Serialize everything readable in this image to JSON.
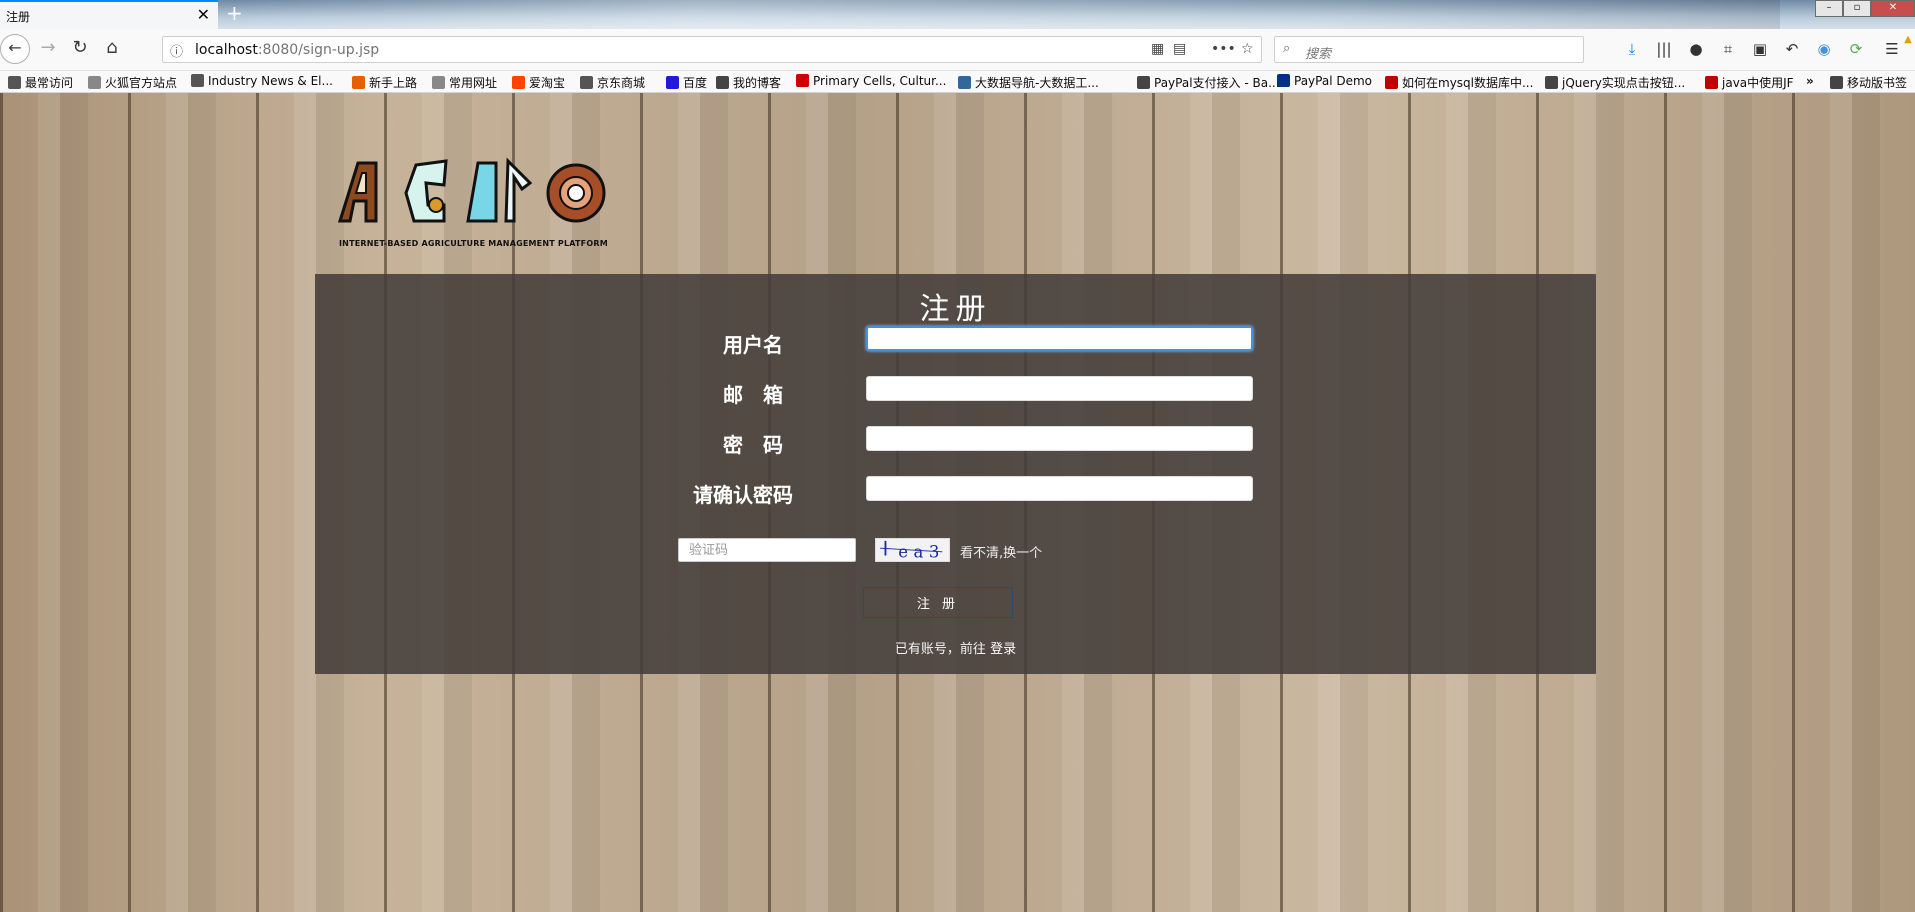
{
  "browser": {
    "tab_title": "注册",
    "new_tab_symbol": "+",
    "close_symbol": "✕",
    "url_host": "localhost",
    "url_rest": ":8080/sign-up.jsp",
    "search_placeholder": "搜索"
  },
  "bookmarks": [
    {
      "label": "最常访问",
      "icon": "gear-icon",
      "color": "#555555"
    },
    {
      "label": "火狐官方站点",
      "icon": "folder-icon",
      "color": "#888888"
    },
    {
      "label": "Industry News & El...",
      "icon": "globe-icon",
      "color": "#555555"
    },
    {
      "label": "新手上路",
      "icon": "firefox-icon",
      "color": "#e66000"
    },
    {
      "label": "常用网址",
      "icon": "folder-icon",
      "color": "#888888"
    },
    {
      "label": "爱淘宝",
      "icon": "taobao-icon",
      "color": "#ff4400"
    },
    {
      "label": "京东商城",
      "icon": "globe-icon",
      "color": "#555555"
    },
    {
      "label": "百度",
      "icon": "baidu-icon",
      "color": "#2319dc"
    },
    {
      "label": "我的博客",
      "icon": "blog-icon",
      "color": "#444444"
    },
    {
      "label": "Primary Cells, Cultur...",
      "icon": "cells-icon",
      "color": "#d00000"
    },
    {
      "label": "大数据导航-大数据工...",
      "icon": "bigdata-icon",
      "color": "#336699"
    },
    {
      "label": "PayPal支付接入 - Ba...",
      "icon": "blog-icon",
      "color": "#444444"
    },
    {
      "label": "PayPal Demo",
      "icon": "paypal-icon",
      "color": "#003087"
    },
    {
      "label": "如何在mysql数据库中...",
      "icon": "csdn-icon",
      "color": "#c00000"
    },
    {
      "label": "jQuery实现点击按钮...",
      "icon": "blog-icon",
      "color": "#444444"
    },
    {
      "label": "java中使用JF",
      "icon": "csdn-icon",
      "color": "#c00000"
    },
    {
      "label": "移动版书签",
      "icon": "mobile-icon",
      "color": "#444444"
    }
  ],
  "logo": {
    "subtitle": "INTERNET-BASED AGRICULTURE MANAGEMENT PLATFORM"
  },
  "form": {
    "title": "注册",
    "username_label": "用户名",
    "email_label": "邮　箱",
    "password_label": "密　码",
    "confirm_label": "请确认密码",
    "captcha_placeholder": "验证码",
    "captcha_text": "ea3",
    "captcha_refresh": "看不清,换一个",
    "submit_label": "注 册",
    "login_prompt": "已有账号，前往",
    "login_link": "登录"
  }
}
